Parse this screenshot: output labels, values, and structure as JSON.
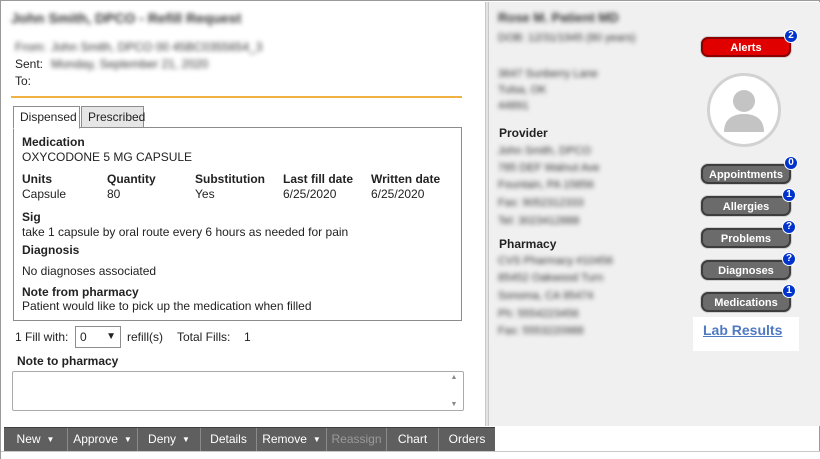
{
  "message": {
    "title": "John Smith, DPCO - Refill Request",
    "from_label": "From:",
    "from_value": "John Smith, DPCO 00 45BC0355654_3",
    "sent_label": "Sent:",
    "sent_value": "Monday, September 21, 2020",
    "to_label": "To:"
  },
  "tabs": [
    {
      "label": "Dispensed",
      "active": true
    },
    {
      "label": "Prescribed",
      "active": false
    }
  ],
  "dispensed": {
    "medication_label": "Medication",
    "medication_value": "OXYCODONE 5 MG CAPSULE",
    "columns": [
      {
        "header": "Units",
        "value": "Capsule"
      },
      {
        "header": "Quantity",
        "value": "80"
      },
      {
        "header": "Substitution",
        "value": "Yes"
      },
      {
        "header": "Last fill date",
        "value": "6/25/2020"
      },
      {
        "header": "Written date",
        "value": "6/25/2020"
      }
    ],
    "sig_label": "Sig",
    "sig_value": "take 1 capsule by oral route  every 6 hours as needed for pain",
    "diagnosis_label": "Diagnosis",
    "diagnosis_value": "No diagnoses associated",
    "note_label": "Note from pharmacy",
    "note_value": "Patient would like to pick up the medication when filled"
  },
  "fill": {
    "prefix": "1 Fill with:",
    "selected": "0",
    "suffix": "refill(s)",
    "total_label": "Total Fills:",
    "total_value": "1"
  },
  "note_to_pharmacy": {
    "label": "Note to pharmacy",
    "value": ""
  },
  "patient": {
    "name": "Rose M. Patient MD",
    "dob": "DOB: 12/31/1945 (80 years)",
    "address_lines": [
      "3647 Sunberry Lane",
      "Tulsa, OK",
      "44891"
    ]
  },
  "provider": {
    "heading": "Provider",
    "lines": [
      "John Smith, DPCO",
      "785 DEF Walnut Ave",
      "Fountain, PA 15856",
      "Fax: 9052312333",
      "Tel: 3023412888"
    ]
  },
  "pharmacy": {
    "heading": "Pharmacy",
    "lines": [
      "CVS Pharmacy #10456",
      "85452 Oakwood Turn",
      "Sonoma, CA 95474",
      "Ph: 5554223456",
      "Fax: 5553220988"
    ]
  },
  "side_buttons": [
    {
      "label": "Alerts",
      "badge": "2",
      "color": "#e00000"
    },
    {
      "label": "Appointments",
      "badge": "0"
    },
    {
      "label": "Allergies",
      "badge": "1"
    },
    {
      "label": "Problems",
      "badge": "?"
    },
    {
      "label": "Diagnoses",
      "badge": "?"
    },
    {
      "label": "Medications",
      "badge": "1"
    }
  ],
  "lab_results_link": "Lab Results",
  "toolbar": [
    {
      "label": "New",
      "dropdown": true,
      "disabled": false
    },
    {
      "label": "Approve",
      "dropdown": true,
      "disabled": false
    },
    {
      "label": "Deny",
      "dropdown": true,
      "disabled": false
    },
    {
      "label": "Details",
      "dropdown": false,
      "disabled": false
    },
    {
      "label": "Remove",
      "dropdown": true,
      "disabled": false
    },
    {
      "label": "Reassign",
      "dropdown": false,
      "disabled": true
    },
    {
      "label": "Chart",
      "dropdown": false,
      "disabled": false
    },
    {
      "label": "Orders",
      "dropdown": false,
      "disabled": false
    }
  ],
  "icons": {
    "avatar": "person-silhouette-icon",
    "dropdown": "chevron-down-icon",
    "scroll_up": "scroll-up-arrow-icon",
    "scroll_down": "scroll-down-arrow-icon"
  },
  "colors": {
    "accent_rule": "#f0b341",
    "alert_red": "#e00000",
    "badge_blue": "#0033cc",
    "link_blue": "#4f79c2",
    "toolbar_bg": "#5f5f5f"
  }
}
